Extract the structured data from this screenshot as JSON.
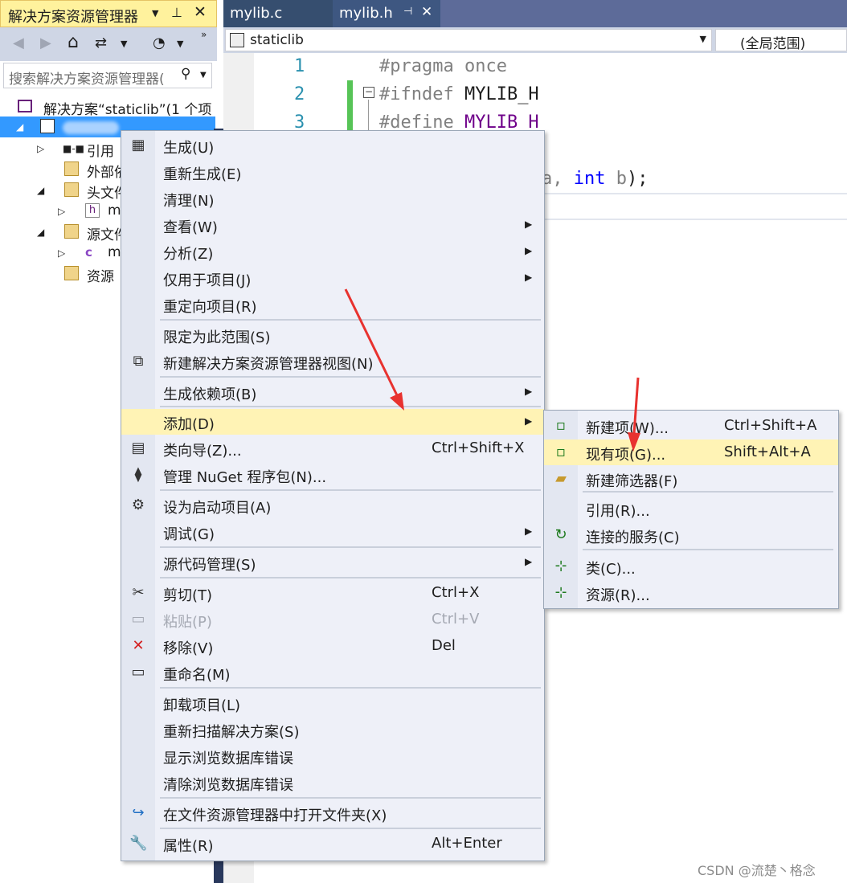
{
  "solution_explorer": {
    "title": "解决方案资源管理器",
    "search_placeholder": "搜索解决方案资源管理器(",
    "solution_label": "解决方案“staticlib”(1 个项",
    "tree": [
      {
        "label": "引用",
        "icon": "references-icon"
      },
      {
        "label": "外部依",
        "icon": "external-deps-icon"
      },
      {
        "label": "头文件",
        "icon": "folder-filter-icon"
      },
      {
        "label": "m",
        "icon": "header-file-icon"
      },
      {
        "label": "源文件",
        "icon": "folder-filter-icon"
      },
      {
        "label": "m",
        "icon": "c-file-icon"
      },
      {
        "label": "资源",
        "icon": "folder-filter-icon"
      }
    ]
  },
  "editor": {
    "tabs": [
      {
        "label": "mylib.c",
        "active": false
      },
      {
        "label": "mylib.h",
        "active": true
      }
    ],
    "nav_project": "staticlib",
    "nav_scope": "(全局范围)",
    "line_numbers": [
      "1",
      "2",
      "3"
    ],
    "code": {
      "l1_a": "#pragma",
      "l1_b": " once",
      "l2_a": "#ifndef",
      "l2_b": " MYLIB_H",
      "l3_a": "#define",
      "l3_b": " MYLIB_H",
      "l5_a": "a,",
      "l5_kw": "int",
      "l5_b": " b",
      "l5_c": ");"
    }
  },
  "context_menu": {
    "items": [
      {
        "label": "生成(U)",
        "icon": "build-icon",
        "shortcut": "",
        "submenu": false
      },
      {
        "label": "重新生成(E)",
        "icon": "",
        "shortcut": "",
        "submenu": false
      },
      {
        "label": "清理(N)",
        "icon": "",
        "shortcut": "",
        "submenu": false
      },
      {
        "label": "查看(W)",
        "icon": "",
        "shortcut": "",
        "submenu": true
      },
      {
        "label": "分析(Z)",
        "icon": "",
        "shortcut": "",
        "submenu": true
      },
      {
        "label": "仅用于项目(J)",
        "icon": "",
        "shortcut": "",
        "submenu": true
      },
      {
        "label": "重定向项目(R)",
        "icon": "",
        "shortcut": "",
        "submenu": false
      },
      {
        "label": "限定为此范围(S)",
        "icon": "",
        "shortcut": "",
        "submenu": false
      },
      {
        "label": "新建解决方案资源管理器视图(N)",
        "icon": "new-view-icon",
        "shortcut": "",
        "submenu": false
      },
      {
        "label": "生成依赖项(B)",
        "icon": "",
        "shortcut": "",
        "submenu": true
      },
      {
        "label": "添加(D)",
        "icon": "",
        "shortcut": "",
        "submenu": true,
        "highlighted": true
      },
      {
        "label": "类向导(Z)...",
        "icon": "class-wizard-icon",
        "shortcut": "Ctrl+Shift+X",
        "submenu": false
      },
      {
        "label": "管理 NuGet 程序包(N)...",
        "icon": "nuget-icon",
        "shortcut": "",
        "submenu": false
      },
      {
        "label": "设为启动项目(A)",
        "icon": "gear-icon",
        "shortcut": "",
        "submenu": false
      },
      {
        "label": "调试(G)",
        "icon": "",
        "shortcut": "",
        "submenu": true
      },
      {
        "label": "源代码管理(S)",
        "icon": "",
        "shortcut": "",
        "submenu": true
      },
      {
        "label": "剪切(T)",
        "icon": "scissors-icon",
        "shortcut": "Ctrl+X",
        "submenu": false
      },
      {
        "label": "粘贴(P)",
        "icon": "paste-icon",
        "shortcut": "Ctrl+V",
        "submenu": false,
        "disabled": true
      },
      {
        "label": "移除(V)",
        "icon": "remove-x-icon",
        "shortcut": "Del",
        "submenu": false
      },
      {
        "label": "重命名(M)",
        "icon": "rename-icon",
        "shortcut": "",
        "submenu": false
      },
      {
        "label": "卸载项目(L)",
        "icon": "",
        "shortcut": "",
        "submenu": false
      },
      {
        "label": "重新扫描解决方案(S)",
        "icon": "",
        "shortcut": "",
        "submenu": false
      },
      {
        "label": "显示浏览数据库错误",
        "icon": "",
        "shortcut": "",
        "submenu": false
      },
      {
        "label": "清除浏览数据库错误",
        "icon": "",
        "shortcut": "",
        "submenu": false
      },
      {
        "label": "在文件资源管理器中打开文件夹(X)",
        "icon": "open-folder-arrow-icon",
        "shortcut": "",
        "submenu": false
      },
      {
        "label": "属性(R)",
        "icon": "wrench-icon",
        "shortcut": "Alt+Enter",
        "submenu": false
      }
    ]
  },
  "add_submenu": {
    "items": [
      {
        "label": "新建项(W)...",
        "icon": "new-item-icon",
        "shortcut": "Ctrl+Shift+A"
      },
      {
        "label": "现有项(G)...",
        "icon": "existing-item-icon",
        "shortcut": "Shift+Alt+A",
        "highlighted": true
      },
      {
        "label": "新建筛选器(F)",
        "icon": "new-filter-icon",
        "shortcut": ""
      },
      {
        "label": "引用(R)...",
        "icon": "",
        "shortcut": ""
      },
      {
        "label": "连接的服务(C)",
        "icon": "connected-service-icon",
        "shortcut": ""
      },
      {
        "label": "类(C)...",
        "icon": "class-icon",
        "shortcut": ""
      },
      {
        "label": "资源(R)...",
        "icon": "resource-icon",
        "shortcut": ""
      }
    ]
  },
  "watermark": "CSDN @流楚丶格念",
  "colors": {
    "accent_tab": "#fff29d",
    "selection": "#3399ff",
    "menu_highlight": "#fff3b5",
    "arrow": "#e8322f"
  }
}
